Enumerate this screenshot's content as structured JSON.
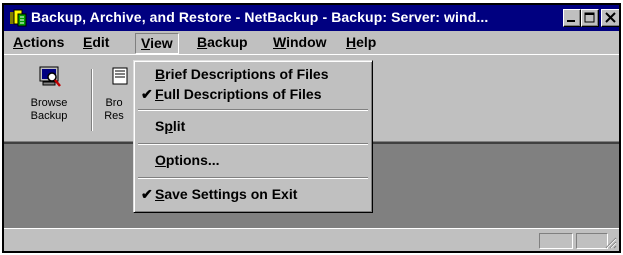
{
  "window": {
    "title": "Backup, Archive, and Restore - NetBackup - Backup: Server: wind...",
    "app_icon": "netbackup-app-icon",
    "controls": [
      "minimize-icon",
      "maximize-icon",
      "close-icon"
    ]
  },
  "menubar": {
    "items": [
      {
        "accel": "A",
        "rest": "ctions"
      },
      {
        "accel": "E",
        "rest": "dit"
      },
      {
        "accel": "V",
        "rest": "iew"
      },
      {
        "accel": "B",
        "rest": "ackup"
      },
      {
        "accel": "W",
        "rest": "indow"
      },
      {
        "accel": "H",
        "rest": "elp"
      }
    ],
    "active": "View"
  },
  "toolbar": {
    "buttons": [
      {
        "label_line1": "Browse",
        "label_line2": "Backup",
        "icon": "browse-backup-icon"
      },
      {
        "label_line1": "Bro",
        "label_line2": "Res",
        "icon": "browse-restore-icon"
      }
    ]
  },
  "view_menu": {
    "items": [
      {
        "pre": "",
        "accel": "B",
        "post": "rief Descriptions of Files",
        "checked": false
      },
      {
        "pre": "",
        "accel": "F",
        "post": "ull Descriptions of Files",
        "checked": true
      },
      {
        "pre": "S",
        "accel": "p",
        "post": "lit",
        "checked": false
      },
      {
        "pre": "",
        "accel": "O",
        "post": "ptions...",
        "checked": false
      },
      {
        "pre": "",
        "accel": "S",
        "post": "ave Settings on Exit",
        "checked": true
      }
    ],
    "check_glyph": "✔"
  },
  "colors": {
    "title_bar": "#000080",
    "face": "#c0c0c0",
    "workspace": "#808080"
  }
}
